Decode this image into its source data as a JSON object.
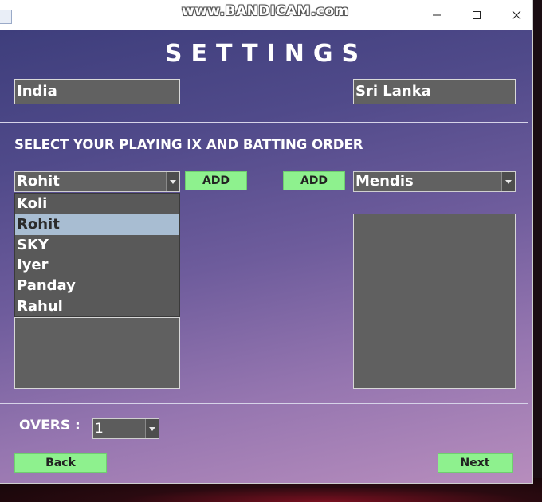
{
  "watermark": "www.BANDICAM.com",
  "window": {
    "icon": "java-icon"
  },
  "settings": {
    "heading": "SETTINGS",
    "team_left": "India",
    "team_right": "Sri Lanka",
    "section_label": "SELECT YOUR PLAYING IX AND BATTING ORDER",
    "left_player_selected": "Rohit",
    "right_player_selected": "Mendis",
    "add_left_label": "ADD",
    "add_right_label": "ADD",
    "left_dropdown_options": [
      "Koli",
      "Rohit",
      "SKY",
      "Iyer",
      "Panday",
      "Rahul"
    ],
    "left_dropdown_highlighted": "Rohit",
    "overs_label": "OVERS :",
    "overs_value": "1",
    "back_label": "Back",
    "next_label": "Next"
  },
  "colors": {
    "button_green": "#8ef18e",
    "field_gray": "#616161",
    "highlight": "#a8bdd2"
  }
}
